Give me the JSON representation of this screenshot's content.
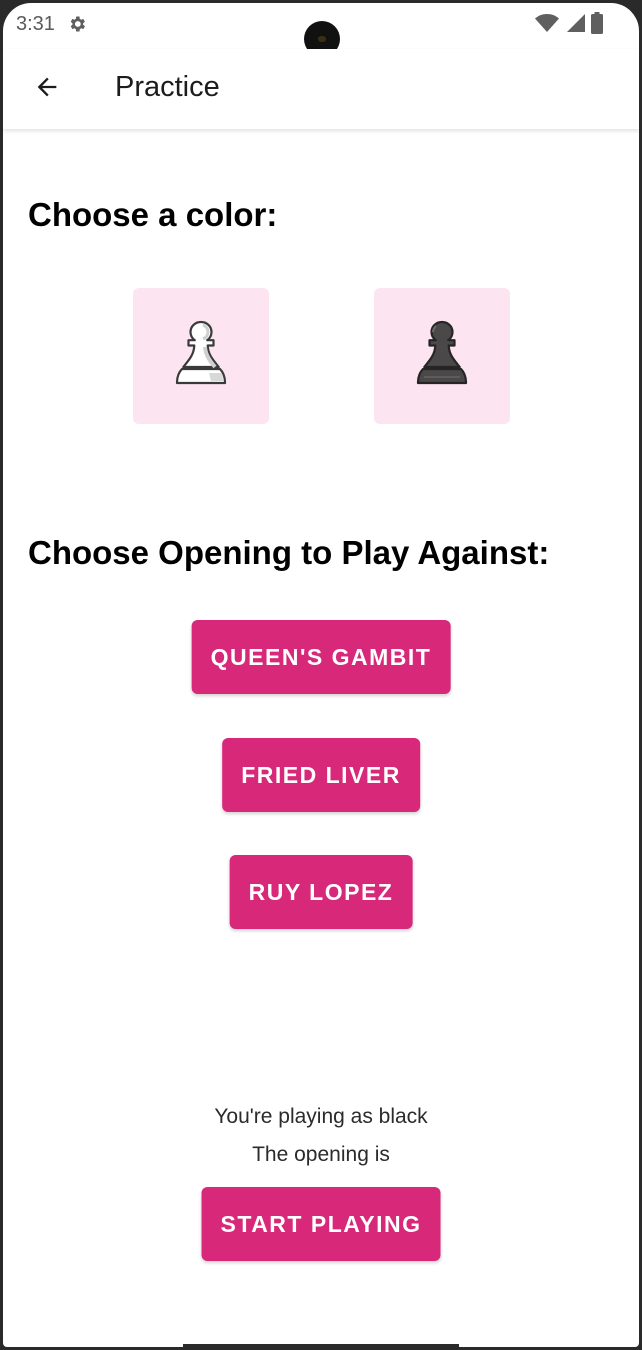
{
  "status_bar": {
    "time": "3:31",
    "icons": [
      "settings-gear-icon",
      "wifi-icon",
      "cell-signal-icon",
      "battery-icon"
    ]
  },
  "app_bar": {
    "title": "Practice",
    "back_icon": "arrow-back-icon"
  },
  "color_section": {
    "heading": "Choose a color:",
    "options": [
      {
        "name": "white",
        "icon": "white-pawn-icon"
      },
      {
        "name": "black",
        "icon": "black-pawn-icon"
      }
    ]
  },
  "opening_section": {
    "heading": "Choose Opening to Play Against:",
    "openings": [
      "QUEEN'S GAMBIT",
      "FRIED LIVER",
      "RUY LOPEZ"
    ]
  },
  "summary": {
    "playing_as": "You're playing as black",
    "opening_line": "The opening is"
  },
  "start_button": "START PLAYING",
  "colors": {
    "accent": "#d8287a",
    "tile_background": "#fce4f1",
    "text": "#000000"
  }
}
